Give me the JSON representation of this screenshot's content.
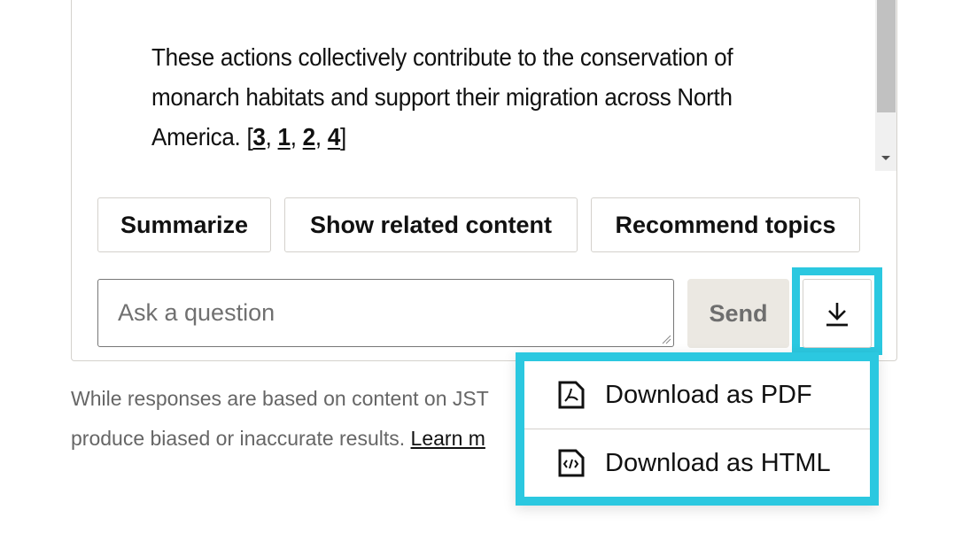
{
  "answer": {
    "text": "These actions collectively contribute to the conservation of monarch habitats and support their migration across North America. [",
    "citations": [
      "3",
      "1",
      "2",
      "4"
    ],
    "close": "]"
  },
  "chips": [
    {
      "label": "Summarize"
    },
    {
      "label": "Show related content"
    },
    {
      "label": "Recommend topics"
    }
  ],
  "input": {
    "placeholder": "Ask a question",
    "value": ""
  },
  "send_label": "Send",
  "download": {
    "icon": "download-icon"
  },
  "disclaimer": {
    "line1": "While responses are based on content on JST",
    "line2": "produce biased or inaccurate results. ",
    "link": "Learn m"
  },
  "menu": {
    "items": [
      {
        "label": "Download as PDF",
        "icon": "pdf-file-icon"
      },
      {
        "label": "Download as HTML",
        "icon": "html-file-icon"
      }
    ]
  },
  "colors": {
    "highlight": "#2bc8e0",
    "send_bg": "#ebe8e2"
  }
}
